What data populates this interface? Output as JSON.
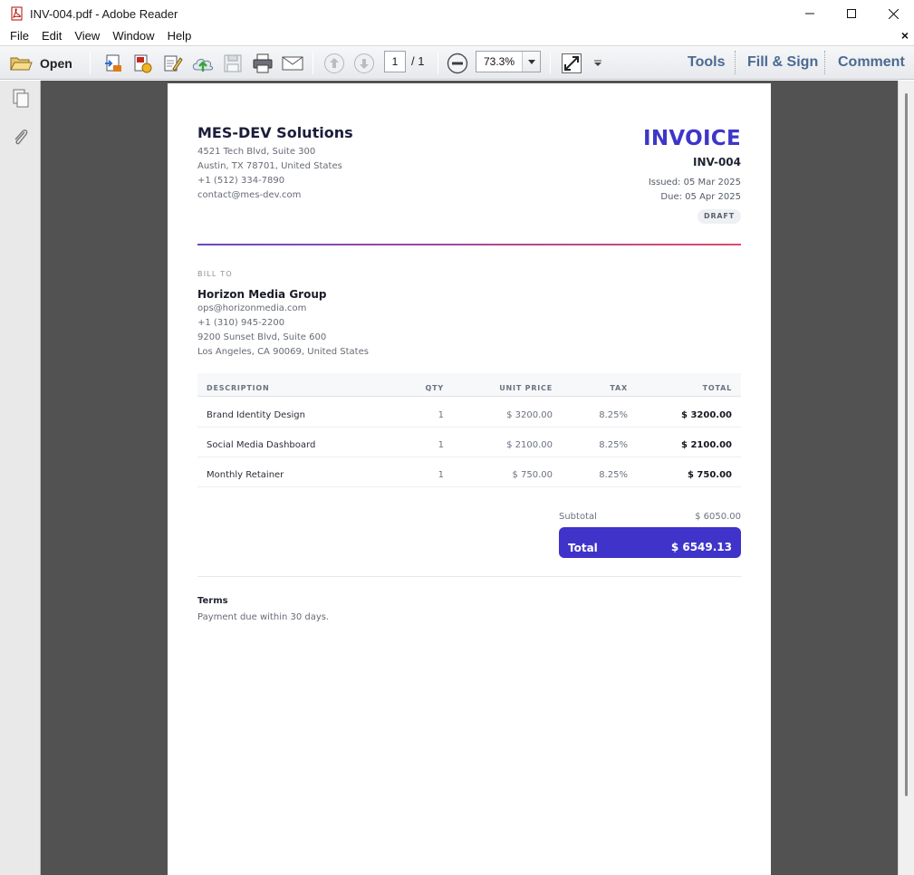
{
  "window": {
    "title": "INV-004.pdf - Adobe Reader"
  },
  "menu": {
    "items": [
      "File",
      "Edit",
      "View",
      "Window",
      "Help"
    ],
    "close": "×"
  },
  "toolbar": {
    "open_label": "Open",
    "page_current": "1",
    "page_total": "/ 1",
    "zoom": "73.3%",
    "links": {
      "tools": "Tools",
      "fill_sign": "Fill & Sign",
      "comment": "Comment"
    },
    "icons": [
      "folder-open-icon",
      "create-pdf-icon",
      "export-pdf-icon",
      "edit-pdf-icon",
      "upload-cloud-icon",
      "save-icon",
      "print-icon",
      "email-icon",
      "prev-page-icon",
      "next-page-icon",
      "zoom-out-icon",
      "fit-page-icon",
      "more-tools-icon"
    ]
  },
  "colors": {
    "accent": "#3f33c9",
    "invoice_title": "#3e35c9",
    "link": "#4b6a92",
    "doc_bg": "#525252"
  },
  "invoice": {
    "company": {
      "name": "MES-DEV Solutions",
      "lines": [
        "4521 Tech Blvd, Suite 300",
        "Austin, TX 78701, United States",
        "+1 (512) 334-7890",
        "contact@mes-dev.com"
      ]
    },
    "title": "INVOICE",
    "number": "INV-004",
    "issued": "Issued: 05 Mar 2025",
    "due": "Due: 05 Apr 2025",
    "status": "DRAFT",
    "bill_to": {
      "label": "BILL TO",
      "name": "Horizon Media Group",
      "lines": [
        "ops@horizonmedia.com",
        "+1 (310) 945-2200",
        "9200 Sunset Blvd, Suite 600",
        "Los Angeles, CA 90069, United States"
      ]
    },
    "table": {
      "headers": {
        "description": "DESCRIPTION",
        "qty": "QTY",
        "unit_price": "UNIT PRICE",
        "tax": "TAX",
        "total": "TOTAL"
      },
      "rows": [
        {
          "description": "Brand Identity Design",
          "qty": "1",
          "unit_price": "$ 3200.00",
          "tax": "8.25%",
          "total": "$ 3200.00"
        },
        {
          "description": "Social Media Dashboard",
          "qty": "1",
          "unit_price": "$ 2100.00",
          "tax": "8.25%",
          "total": "$ 2100.00"
        },
        {
          "description": "Monthly Retainer",
          "qty": "1",
          "unit_price": "$ 750.00",
          "tax": "8.25%",
          "total": "$ 750.00"
        }
      ]
    },
    "subtotal_label": "Subtotal",
    "subtotal": "$ 6050.00",
    "total_label": "Total",
    "total": "$ 6549.13",
    "terms_title": "Terms",
    "terms_text": "Payment due within 30 days."
  }
}
